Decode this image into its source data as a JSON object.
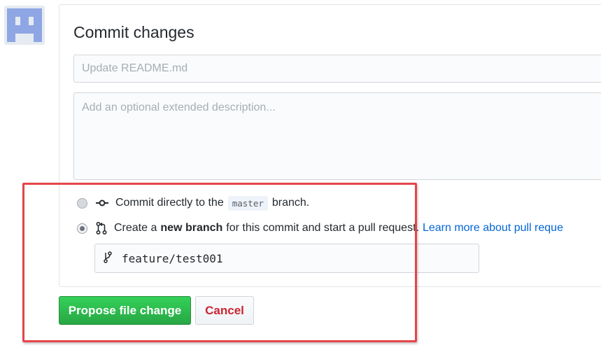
{
  "colors": {
    "primary_button": "#28a745",
    "cancel_text": "#cb2431",
    "link": "#0366d6",
    "highlight_box": "#e5454a",
    "avatar": "#8ea6e4"
  },
  "user": {
    "avatar_icon": "identicon-avatar"
  },
  "commit_form": {
    "title": "Commit changes",
    "summary_placeholder": "Update README.md",
    "summary_value": "",
    "description_placeholder": "Add an optional extended description...",
    "description_value": "",
    "options": [
      {
        "icon": "git-commit-icon",
        "selected": false,
        "text_before": "Commit directly to the",
        "branch_chip": "master",
        "text_after": "branch."
      },
      {
        "icon": "git-pull-request-icon",
        "selected": true,
        "text_before": "Create a",
        "bold_text": "new branch",
        "text_after": "for this commit and start a pull request.",
        "link_text": "Learn more about pull reque"
      }
    ],
    "branch_icon": "git-branch-icon",
    "branch_name": "feature/test001"
  },
  "actions": {
    "propose_label": "Propose file change",
    "cancel_label": "Cancel"
  }
}
